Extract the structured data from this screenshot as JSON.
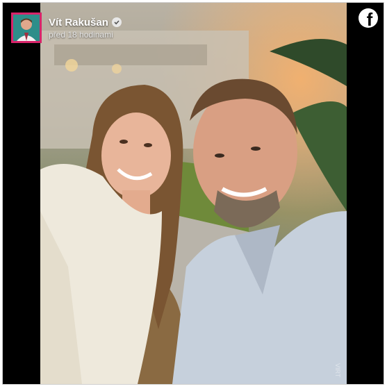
{
  "post": {
    "author_name": "Vít Rakušan",
    "timestamp": "před 18 hodinami",
    "verified_icon": "verified-check-icon",
    "platform_icon": "facebook-logo-icon",
    "photo_watermark": "VIRT"
  },
  "colors": {
    "frame_background": "#000000",
    "avatar_border": "#d8246a",
    "text": "#ffffff"
  }
}
